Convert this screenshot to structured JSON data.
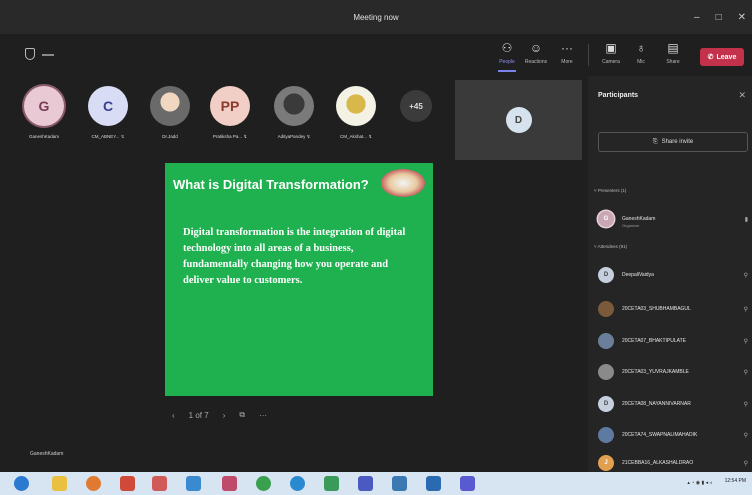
{
  "window": {
    "title": "Meeting now",
    "controls": [
      "–",
      "□",
      "✕"
    ]
  },
  "toolbar": {
    "buttons": [
      {
        "label": "People",
        "icon": "people-icon",
        "glyph": "⚇"
      },
      {
        "label": "Reactions",
        "icon": "reactions-icon",
        "glyph": "☺"
      },
      {
        "label": "More",
        "icon": "more-icon",
        "glyph": "···"
      },
      {
        "label": "Camera",
        "icon": "camera-icon",
        "glyph": "▣"
      },
      {
        "label": "Mic",
        "icon": "mic-icon",
        "glyph": "♁"
      },
      {
        "label": "Share",
        "icon": "share-icon",
        "glyph": "▤"
      }
    ],
    "leave_label": "Leave",
    "leave_color": "#c4314b"
  },
  "participants_strip": [
    {
      "initials": "G",
      "name": "GaneshKadam",
      "bg": "#e8c9d4",
      "fg": "#7a3b55"
    },
    {
      "initials": "C",
      "name": "CM_ABNEY... ↯",
      "bg": "#d9dcf5",
      "fg": "#3a3f8f"
    },
    {
      "initials": "",
      "name": "Dr.Jadd",
      "bg": "#8a8a8a",
      "fg": "#fff"
    },
    {
      "initials": "PP",
      "name": "Pratiksha Pa... ↯",
      "bg": "#f2cfc6",
      "fg": "#8a3b2b"
    },
    {
      "initials": "",
      "name": "AdityaPandey ↯",
      "bg": "#5b5b5b",
      "fg": "#fff"
    },
    {
      "initials": "",
      "name": "CM_Akshat... ↯",
      "bg": "#dcd08a",
      "fg": "#fff"
    },
    {
      "initials": "+45",
      "name": "",
      "bg": "#3b3b3b",
      "fg": "#ddd"
    }
  ],
  "self_tile": {
    "initials": "D"
  },
  "slide": {
    "title": "What is Digital Transformation?",
    "body": "Digital transformation is the integration of digital technology into all areas of a business, fundamentally changing how you operate and deliver value to customers.",
    "color": "#1fb14f"
  },
  "slide_controls": {
    "prev": "‹",
    "page": "1 of 7",
    "next": "›",
    "more": "···"
  },
  "presenter": "GaneshKadam",
  "panel": {
    "title": "Participants",
    "share_invite": "Share invite",
    "presenters_header": "Presenters (1)",
    "attendees_header": "Attendees (91)",
    "presenters": [
      {
        "name": "GaneshKadam",
        "role": "Organizer",
        "initials": "G",
        "bg": "#c9a7b5"
      }
    ],
    "attendees": [
      {
        "name": "DeepaliVaidya",
        "initials": "D",
        "bg": "#c5cfdd"
      },
      {
        "name": "20CETA03_SHUBHAMBAGUL",
        "initials": "",
        "bg": "#7a5a3a"
      },
      {
        "name": "20CETA07_BHAKTIPULATE",
        "initials": "",
        "bg": "#6b7f9b"
      },
      {
        "name": "20CETA03_YUVRAJKAMBLE",
        "initials": "",
        "bg": "#8a8a8a"
      },
      {
        "name": "20CETA08_NAYANNIVARNAR",
        "initials": "D",
        "bg": "#c5cfdd"
      },
      {
        "name": "20CETA74_SWAPNALIMAHADIK",
        "initials": "",
        "bg": "#5e7aa0"
      },
      {
        "name": "21CEBBA16_ALKASHALDRAO",
        "initials": "J",
        "bg": "#e0a050"
      }
    ]
  },
  "taskbar": {
    "icons": [
      {
        "name": "start-icon",
        "color": "#2a7ad0"
      },
      {
        "name": "file-explorer-icon",
        "color": "#e9c040"
      },
      {
        "name": "media-icon",
        "color": "#e07a30"
      },
      {
        "name": "app-icon",
        "color": "#d04a3a"
      },
      {
        "name": "paint-icon",
        "color": "#d05a5a"
      },
      {
        "name": "notes-icon",
        "color": "#3a8ad0"
      },
      {
        "name": "photos-icon",
        "color": "#c04a6a"
      },
      {
        "name": "chrome-icon",
        "color": "#3aa050"
      },
      {
        "name": "edge-icon",
        "color": "#2a8ad0"
      },
      {
        "name": "excel-icon",
        "color": "#3a9a5a"
      },
      {
        "name": "teams-icon",
        "color": "#4a5ac0"
      },
      {
        "name": "folder-icon",
        "color": "#3a7ab0"
      },
      {
        "name": "vscode-icon",
        "color": "#2a6ab0"
      },
      {
        "name": "teams2-icon",
        "color": "#5a5ad0"
      }
    ],
    "time": "12:54 PM"
  }
}
